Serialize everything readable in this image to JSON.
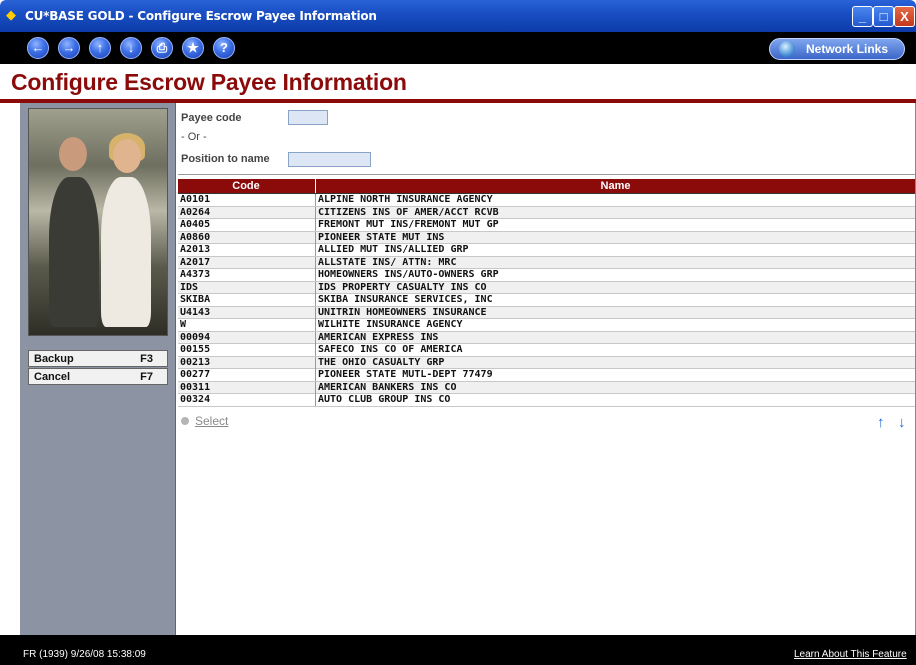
{
  "window": {
    "title": "CU*BASE GOLD - Configure Escrow Payee Information",
    "min": "_",
    "max": "□",
    "close": "X"
  },
  "toolbar": {
    "back": "←",
    "forward": "→",
    "up": "↑",
    "down": "↓",
    "print": "⎙",
    "favorite": "★",
    "help": "?",
    "network_links": "Network Links"
  },
  "page": {
    "title": "Configure Escrow Payee Information"
  },
  "sidebar": {
    "backup": {
      "label": "Backup",
      "key": "F3"
    },
    "cancel": {
      "label": "Cancel",
      "key": "F7"
    }
  },
  "form": {
    "payee_code_label": "Payee code",
    "payee_code_value": "",
    "or_label": "- Or -",
    "position_label": "Position to name",
    "position_value": ""
  },
  "table": {
    "columns": [
      "Code",
      "Name"
    ],
    "rows": [
      [
        "A0101",
        "ALPINE NORTH INSURANCE AGENCY"
      ],
      [
        "A0264",
        "CITIZENS INS OF AMER/ACCT RCVB"
      ],
      [
        "A0405",
        "FREMONT MUT INS/FREMONT MUT GP"
      ],
      [
        "A0860",
        "PIONEER STATE MUT INS"
      ],
      [
        "A2013",
        "ALLIED MUT INS/ALLIED GRP"
      ],
      [
        "A2017",
        "ALLSTATE INS/ ATTN: MRC"
      ],
      [
        "A4373",
        "HOMEOWNERS INS/AUTO-OWNERS GRP"
      ],
      [
        "IDS",
        "IDS PROPERTY CASUALTY INS CO"
      ],
      [
        "SKIBA",
        "SKIBA INSURANCE SERVICES, INC"
      ],
      [
        "U4143",
        "UNITRIN HOMEOWNERS INSURANCE"
      ],
      [
        "W",
        "WILHITE INSURANCE AGENCY"
      ],
      [
        "00094",
        "AMERICAN EXPRESS INS"
      ],
      [
        "00155",
        "SAFECO INS CO OF AMERICA"
      ],
      [
        "00213",
        "THE OHIO CASUALTY GRP"
      ],
      [
        "00277",
        "PIONEER STATE MUTL-DEPT 77479"
      ],
      [
        "00311",
        "AMERICAN BANKERS INS CO"
      ],
      [
        "00324",
        "AUTO CLUB GROUP INS CO"
      ]
    ]
  },
  "actions": {
    "select": "Select",
    "page_up": "↑",
    "page_down": "↓"
  },
  "status": {
    "left": "FR (1939) 9/26/08 15:38:09",
    "learn_link": "Learn About This Feature"
  },
  "colors": {
    "accent": "#8b0a0a",
    "titlebar": "#1a4fc4",
    "sidebar": "#8c94a4"
  }
}
